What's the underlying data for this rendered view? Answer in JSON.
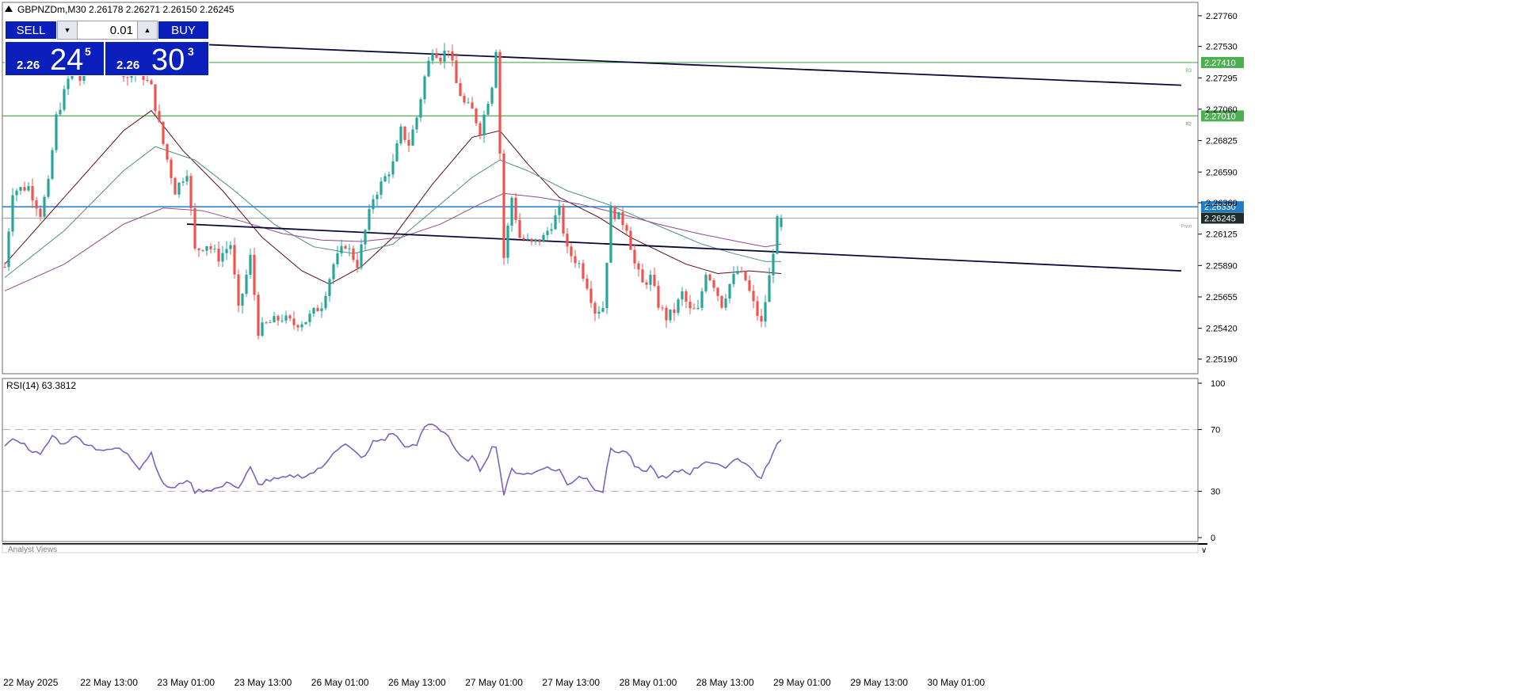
{
  "header": {
    "symbol": "GBPNZDm,M30",
    "ohlc": "2.26178 2.26271 2.26150 2.26245"
  },
  "trade_panel": {
    "sell_label": "SELL",
    "buy_label": "BUY",
    "lot": "0.01",
    "sell_price_prefix": "2.26",
    "sell_price_big": "24",
    "sell_price_sup": "5",
    "buy_price_prefix": "2.26",
    "buy_price_big": "30",
    "buy_price_sup": "3"
  },
  "colors": {
    "bull": "#26a69a",
    "bear": "#ef5350",
    "level_green": "#4caf50",
    "level_blue": "#1e7ec8",
    "panel_blue": "#0b1fbd",
    "trendline": "#0a0a3a",
    "ma_fast": "#5d0a14",
    "ma_mid": "#4f8a8b",
    "ma_slow": "#8e4a8e",
    "rsi_line": "#7c62c0"
  },
  "chart_data": [
    {
      "type": "candlestick",
      "symbol": "GBPNZDm",
      "timeframe": "M30",
      "last_ohlc": {
        "open": 2.26178,
        "high": 2.26271,
        "low": 2.2615,
        "close": 2.26245
      },
      "ylim": [
        2.2508,
        2.2786
      ],
      "y_ticks": [
        "2.27760",
        "2.27530",
        "2.27295",
        "2.27060",
        "2.26825",
        "2.26590",
        "2.26360",
        "2.26125",
        "2.25890",
        "2.25655",
        "2.25420",
        "2.25190"
      ],
      "x_tick_labels": [
        "22 May 2025",
        "22 May 13:00",
        "23 May 01:00",
        "23 May 13:00",
        "26 May 01:00",
        "26 May 13:00",
        "27 May 01:00",
        "27 May 13:00",
        "28 May 01:00",
        "28 May 13:00",
        "29 May 01:00",
        "29 May 13:00",
        "30 May 01:00"
      ],
      "horizontal_levels": [
        {
          "label": "R3",
          "price": 2.2741,
          "price_text": "2.27410",
          "style": "green"
        },
        {
          "label": "R2",
          "price": 2.2701,
          "price_text": "2.27010",
          "style": "green"
        },
        {
          "label": "",
          "price": 2.2633,
          "price_text": "2.26330",
          "style": "blue"
        },
        {
          "label": "Pivot",
          "price": 2.26245,
          "price_text": "2.26245",
          "style": "current"
        }
      ],
      "trendlines": [
        {
          "from": {
            "bar": 46,
            "price": 2.2755
          },
          "to": {
            "bar": 296,
            "price": 2.2724
          }
        },
        {
          "from": {
            "bar": 46,
            "price": 2.262
          },
          "to": {
            "bar": 296,
            "price": 2.2585
          }
        }
      ],
      "close_path": [
        [
          0,
          2.2588
        ],
        [
          2,
          2.2645
        ],
        [
          6,
          2.2648
        ],
        [
          9,
          2.2628
        ],
        [
          11,
          2.265
        ],
        [
          13,
          2.27
        ],
        [
          15,
          2.2718
        ],
        [
          17,
          2.2738
        ],
        [
          19,
          2.2728
        ],
        [
          22,
          2.2745
        ],
        [
          25,
          2.2735
        ],
        [
          28,
          2.2742
        ],
        [
          31,
          2.273
        ],
        [
          34,
          2.2735
        ],
        [
          37,
          2.2722
        ],
        [
          40,
          2.268
        ],
        [
          43,
          2.2645
        ],
        [
          46,
          2.266
        ],
        [
          48,
          2.26
        ],
        [
          51,
          2.2605
        ],
        [
          54,
          2.2595
        ],
        [
          57,
          2.2605
        ],
        [
          59,
          2.2555
        ],
        [
          62,
          2.2595
        ],
        [
          64,
          2.254
        ],
        [
          66,
          2.2545
        ],
        [
          70,
          2.255
        ],
        [
          73,
          2.2545
        ],
        [
          76,
          2.2548
        ],
        [
          80,
          2.256
        ],
        [
          83,
          2.259
        ],
        [
          86,
          2.2605
        ],
        [
          89,
          2.259
        ],
        [
          91,
          2.2615
        ],
        [
          93,
          2.264
        ],
        [
          96,
          2.2655
        ],
        [
          98,
          2.2665
        ],
        [
          100,
          2.269
        ],
        [
          102,
          2.268
        ],
        [
          104,
          2.27
        ],
        [
          106,
          2.273
        ],
        [
          108,
          2.2752
        ],
        [
          110,
          2.2745
        ],
        [
          112,
          2.2752
        ],
        [
          114,
          2.2725
        ],
        [
          116,
          2.271
        ],
        [
          118,
          2.2705
        ],
        [
          120,
          2.269
        ],
        [
          123,
          2.2725
        ],
        [
          124,
          2.2752
        ],
        [
          126,
          2.2595
        ],
        [
          128,
          2.264
        ],
        [
          130,
          2.261
        ],
        [
          133,
          2.2605
        ],
        [
          136,
          2.261
        ],
        [
          138,
          2.262
        ],
        [
          140,
          2.263
        ],
        [
          142,
          2.26
        ],
        [
          145,
          2.259
        ],
        [
          147,
          2.2575
        ],
        [
          149,
          2.2555
        ],
        [
          151,
          2.2558
        ],
        [
          153,
          2.263
        ],
        [
          155,
          2.2625
        ],
        [
          157,
          2.2618
        ],
        [
          159,
          2.259
        ],
        [
          161,
          2.2575
        ],
        [
          163,
          2.258
        ],
        [
          165,
          2.256
        ],
        [
          167,
          2.255
        ],
        [
          169,
          2.2555
        ],
        [
          171,
          2.2568
        ],
        [
          173,
          2.2555
        ],
        [
          175,
          2.2555
        ],
        [
          177,
          2.2585
        ],
        [
          179,
          2.2575
        ],
        [
          181,
          2.256
        ],
        [
          183,
          2.2575
        ],
        [
          185,
          2.2585
        ],
        [
          187,
          2.2578
        ],
        [
          189,
          2.256
        ],
        [
          191,
          2.2545
        ],
        [
          193,
          2.258
        ],
        [
          195,
          2.2622
        ],
        [
          196,
          2.2624
        ]
      ],
      "moving_averages": [
        {
          "color": "ma_fast",
          "path": [
            [
              0,
              2.259
            ],
            [
              15,
              2.264
            ],
            [
              30,
              2.269
            ],
            [
              37,
              2.2705
            ],
            [
              45,
              2.2675
            ],
            [
              55,
              2.2645
            ],
            [
              65,
              2.261
            ],
            [
              75,
              2.2585
            ],
            [
              82,
              2.2575
            ],
            [
              90,
              2.2588
            ],
            [
              98,
              2.261
            ],
            [
              108,
              2.265
            ],
            [
              118,
              2.2685
            ],
            [
              125,
              2.269
            ],
            [
              132,
              2.2665
            ],
            [
              140,
              2.264
            ],
            [
              150,
              2.2625
            ],
            [
              158,
              2.261
            ],
            [
              165,
              2.26
            ],
            [
              172,
              2.259
            ],
            [
              180,
              2.2583
            ],
            [
              188,
              2.2585
            ],
            [
              196,
              2.2583
            ]
          ]
        },
        {
          "color": "ma_mid",
          "path": [
            [
              0,
              2.258
            ],
            [
              15,
              2.2615
            ],
            [
              30,
              2.266
            ],
            [
              38,
              2.2678
            ],
            [
              48,
              2.2668
            ],
            [
              58,
              2.2645
            ],
            [
              68,
              2.262
            ],
            [
              78,
              2.2603
            ],
            [
              88,
              2.2598
            ],
            [
              98,
              2.2605
            ],
            [
              108,
              2.263
            ],
            [
              118,
              2.2655
            ],
            [
              125,
              2.2668
            ],
            [
              132,
              2.266
            ],
            [
              142,
              2.2645
            ],
            [
              152,
              2.2635
            ],
            [
              160,
              2.2625
            ],
            [
              168,
              2.2615
            ],
            [
              176,
              2.2605
            ],
            [
              184,
              2.2598
            ],
            [
              192,
              2.2592
            ],
            [
              196,
              2.2592
            ]
          ]
        },
        {
          "color": "ma_slow",
          "path": [
            [
              0,
              2.257
            ],
            [
              15,
              2.259
            ],
            [
              30,
              2.262
            ],
            [
              40,
              2.2632
            ],
            [
              50,
              2.263
            ],
            [
              60,
              2.2622
            ],
            [
              70,
              2.2613
            ],
            [
              80,
              2.2608
            ],
            [
              90,
              2.2607
            ],
            [
              100,
              2.261
            ],
            [
              110,
              2.262
            ],
            [
              120,
              2.2635
            ],
            [
              126,
              2.2643
            ],
            [
              135,
              2.264
            ],
            [
              145,
              2.2635
            ],
            [
              155,
              2.2628
            ],
            [
              165,
              2.262
            ],
            [
              175,
              2.2613
            ],
            [
              185,
              2.2607
            ],
            [
              192,
              2.2603
            ],
            [
              196,
              2.2605
            ]
          ]
        }
      ]
    },
    {
      "type": "line",
      "title": "RSI(14) 63.3812",
      "ylim": [
        0,
        100
      ],
      "y_ticks": [
        "100",
        "70",
        "30",
        "0"
      ],
      "levels": [
        70,
        30
      ],
      "path": [
        [
          0,
          60
        ],
        [
          3,
          64
        ],
        [
          6,
          58
        ],
        [
          9,
          53
        ],
        [
          12,
          66
        ],
        [
          15,
          60
        ],
        [
          17,
          66
        ],
        [
          20,
          62
        ],
        [
          23,
          58
        ],
        [
          26,
          56
        ],
        [
          28,
          58
        ],
        [
          31,
          55
        ],
        [
          34,
          45
        ],
        [
          37,
          55
        ],
        [
          40,
          34
        ],
        [
          43,
          32
        ],
        [
          46,
          38
        ],
        [
          48,
          30
        ],
        [
          51,
          31
        ],
        [
          54,
          32
        ],
        [
          57,
          36
        ],
        [
          59,
          32
        ],
        [
          62,
          45
        ],
        [
          64,
          34
        ],
        [
          66,
          37
        ],
        [
          70,
          38
        ],
        [
          73,
          40
        ],
        [
          76,
          40
        ],
        [
          80,
          45
        ],
        [
          83,
          56
        ],
        [
          86,
          60
        ],
        [
          89,
          54
        ],
        [
          91,
          52
        ],
        [
          93,
          62
        ],
        [
          96,
          64
        ],
        [
          98,
          68
        ],
        [
          100,
          62
        ],
        [
          102,
          58
        ],
        [
          104,
          60
        ],
        [
          106,
          72
        ],
        [
          108,
          74
        ],
        [
          110,
          70
        ],
        [
          112,
          66
        ],
        [
          114,
          55
        ],
        [
          116,
          50
        ],
        [
          118,
          52
        ],
        [
          120,
          44
        ],
        [
          123,
          58
        ],
        [
          124,
          60
        ],
        [
          126,
          28
        ],
        [
          128,
          44
        ],
        [
          130,
          42
        ],
        [
          133,
          41
        ],
        [
          136,
          46
        ],
        [
          138,
          44
        ],
        [
          140,
          44
        ],
        [
          142,
          34
        ],
        [
          145,
          40
        ],
        [
          147,
          38
        ],
        [
          149,
          32
        ],
        [
          151,
          30
        ],
        [
          153,
          58
        ],
        [
          155,
          55
        ],
        [
          157,
          56
        ],
        [
          159,
          46
        ],
        [
          161,
          42
        ],
        [
          163,
          46
        ],
        [
          165,
          40
        ],
        [
          167,
          38
        ],
        [
          169,
          42
        ],
        [
          171,
          44
        ],
        [
          173,
          42
        ],
        [
          175,
          46
        ],
        [
          177,
          50
        ],
        [
          179,
          48
        ],
        [
          181,
          45
        ],
        [
          183,
          48
        ],
        [
          185,
          52
        ],
        [
          187,
          48
        ],
        [
          189,
          43
        ],
        [
          191,
          38
        ],
        [
          193,
          50
        ],
        [
          195,
          60
        ],
        [
          196,
          63
        ]
      ]
    }
  ],
  "bottom_tab": "Analyst Views"
}
